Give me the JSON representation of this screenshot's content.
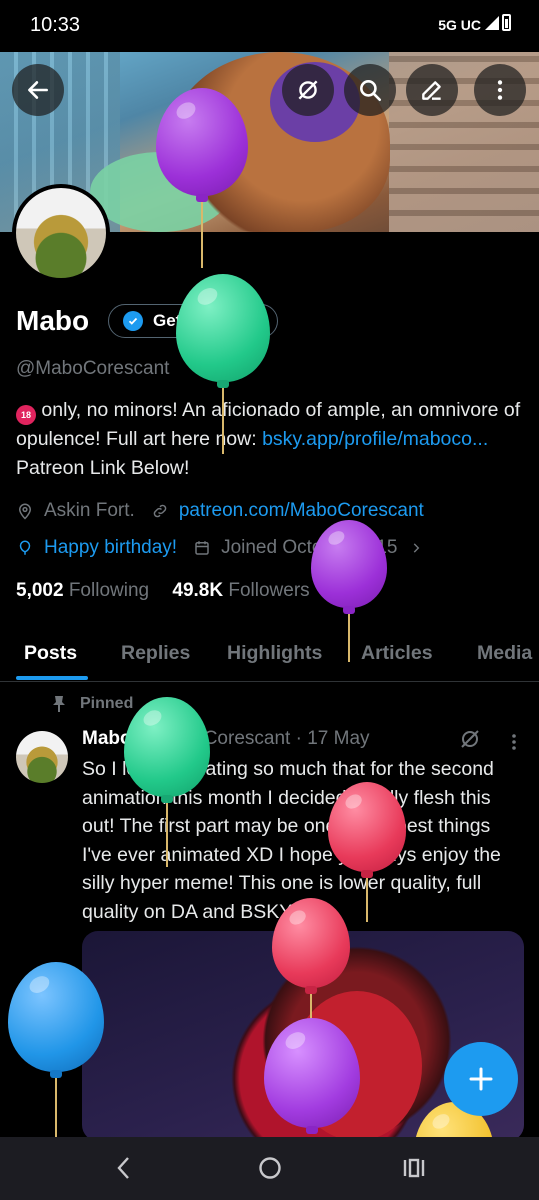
{
  "status_bar": {
    "time": "10:33",
    "network": "5G UC"
  },
  "header": {
    "back_label": "",
    "icons": [
      "back-arrow-icon",
      "grok-icon",
      "search-icon",
      "edit-icon",
      "more-icon"
    ]
  },
  "profile": {
    "display_name": "Mabo",
    "verify_label": "Get verified",
    "handle": "@MaboCorescant",
    "bio": {
      "emoji": "🔞",
      "text1": " only, no minors! An aficionado of ample, an omnivore of opulence!  Full art here now: ",
      "link1": "bsky.app/profile/maboco...",
      "text2": " Patreon Link Below!"
    },
    "location": "Askin Fort.",
    "website": "patreon.com/MaboCorescant",
    "birthday": "Happy birthday!",
    "joined": "Joined October 2015",
    "following_count": "5,002",
    "following_label": "Following",
    "followers_count": "49.8K",
    "followers_label": "Followers"
  },
  "tabs": [
    "Posts",
    "Replies",
    "Highlights",
    "Articles",
    "Media"
  ],
  "pinned_post": {
    "pinned_label": "Pinned",
    "author": "Mabo",
    "handle": "@MaboCorescant",
    "date": "17 May",
    "separator": "·",
    "text": "So I love animating so much that for the second animation this month I decided to fully flesh this out! The first part may be one of the best things I've ever animated XD I hope you guys enjoy the silly hyper meme! This one is lower quality, full quality on DA and BSKY!"
  },
  "colors": {
    "accent": "#1d9bf0",
    "balloon_purple": "#a23ce0",
    "balloon_green": "#21c98a",
    "balloon_red": "#e83a5a",
    "balloon_blue": "#2196e8",
    "balloon_yellow": "#f2c230"
  },
  "fab_icon": "plus-icon",
  "nav": [
    "back-nav-icon",
    "home-nav-icon",
    "recents-nav-icon"
  ]
}
